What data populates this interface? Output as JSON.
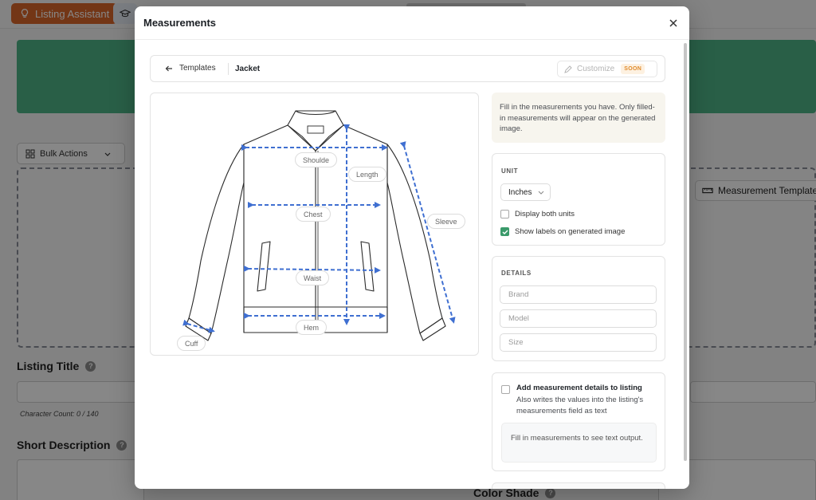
{
  "background": {
    "listing_assistant_label": "Listing Assistant",
    "bulk_actions_label": "Bulk Actions",
    "measurement_templates_label": "Measurement Template",
    "listing_title_label": "Listing Title",
    "character_count": "Character Count: 0 / 140",
    "short_description_label": "Short Description",
    "color_shade_label": "Color Shade",
    "help_mark": "?",
    "accent_color": "#d9662b",
    "banner_color": "#4fb386"
  },
  "modal": {
    "title": "Measurements",
    "close_icon": "close-icon",
    "nav": {
      "back_label": "Templates",
      "current": "Jacket",
      "customize_label": "Customize",
      "soon_badge": "SOON"
    },
    "diagram": {
      "garment": "jacket",
      "labels": {
        "shoulder": "Shoulde",
        "length": "Length",
        "sleeve": "Sleeve",
        "chest": "Chest",
        "waist": "Waist",
        "hem": "Hem",
        "cuff": "Cuff"
      },
      "arrow_color": "#3f6fd1"
    },
    "info_text": "Fill in the measurements you have. Only filled-in measurements will appear on the generated image.",
    "unit": {
      "section_label": "UNIT",
      "selected": "Inches",
      "display_both_units": {
        "label": "Display both units",
        "checked": false
      },
      "show_labels": {
        "label": "Show labels on generated image",
        "checked": true
      }
    },
    "details": {
      "section_label": "DETAILS",
      "brand_placeholder": "Brand",
      "model_placeholder": "Model",
      "size_placeholder": "Size"
    },
    "add_details": {
      "title": "Add measurement details to listing",
      "description": "Also writes the values into the listing's measurements field as text",
      "checked": false,
      "output_placeholder": "Fill in measurements to see text output."
    }
  }
}
